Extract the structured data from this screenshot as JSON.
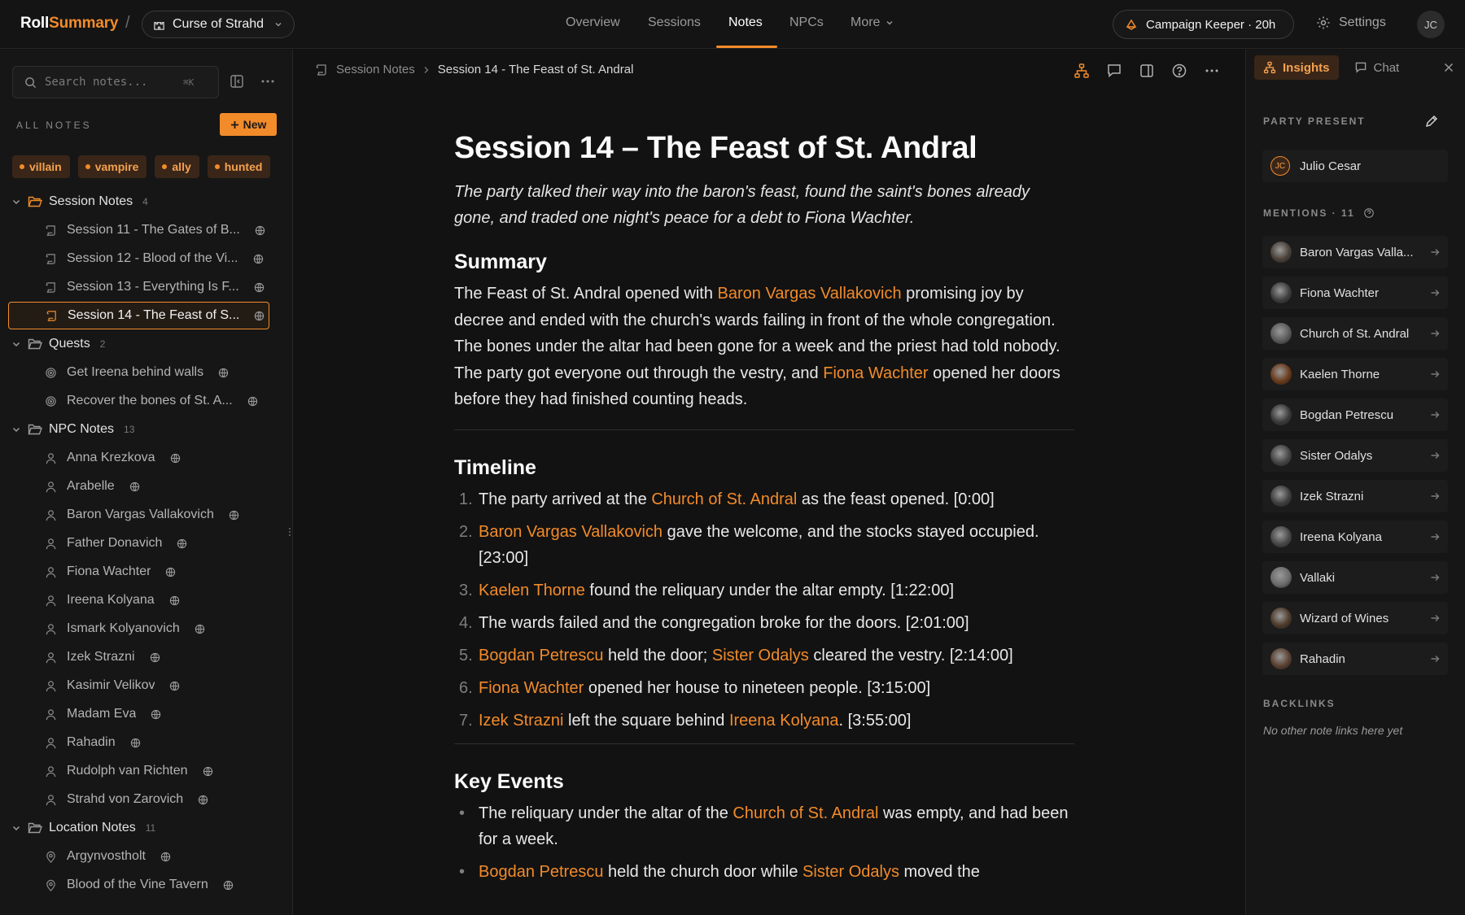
{
  "topbar": {
    "logo_a": "Roll",
    "logo_b": "Summary",
    "campaign": "Curse of Strahd",
    "tabs": [
      "Overview",
      "Sessions",
      "Notes",
      "NPCs",
      "More"
    ],
    "active_tab": "Notes",
    "keeper": "Campaign Keeper · 20h",
    "settings": "Settings",
    "avatar": "JC"
  },
  "sidebar": {
    "search_placeholder": "Search notes...",
    "search_kbd": "⌘K",
    "all_notes": "ALL NOTES",
    "new_label": "New",
    "tags": [
      "villain",
      "vampire",
      "ally",
      "hunted"
    ],
    "folders": {
      "session": {
        "name": "Session Notes",
        "count": "4",
        "items": [
          "Session 11 - The Gates of B...",
          "Session 12 - Blood of the Vi...",
          "Session 13 - Everything Is F...",
          "Session 14 - The Feast of S..."
        ]
      },
      "quests": {
        "name": "Quests",
        "count": "2",
        "items": [
          "Get Ireena behind walls",
          "Recover the bones of St. A..."
        ]
      },
      "npc": {
        "name": "NPC Notes",
        "count": "13",
        "items": [
          "Anna Krezkova",
          "Arabelle",
          "Baron Vargas Vallakovich",
          "Father Donavich",
          "Fiona Wachter",
          "Ireena Kolyana",
          "Ismark Kolyanovich",
          "Izek Strazni",
          "Kasimir Velikov",
          "Madam Eva",
          "Rahadin",
          "Rudolph van Richten",
          "Strahd von Zarovich"
        ]
      },
      "location": {
        "name": "Location Notes",
        "count": "11",
        "items": [
          "Argynvostholt",
          "Blood of the Vine Tavern"
        ]
      }
    }
  },
  "main": {
    "breadcrumb_root": "Session Notes",
    "breadcrumb_current": "Session 14 - The Feast of St. Andral",
    "title": "Session 14 – The Feast of St. Andral",
    "lede": "The party talked their way into the baron's feast, found the saint's bones already gone, and traded one night's peace for a debt to Fiona Wachter.",
    "summary": {
      "heading": "Summary",
      "t1": "The Feast of St. Andral opened with ",
      "l1": "Baron Vargas Vallakovich",
      "t2": " promising joy by decree and ended with the church's wards failing in front of the whole congregation. The bones under the altar had been gone for a week and the priest had told nobody. The party got everyone out through the vestry, and ",
      "l2": "Fiona Wachter",
      "t3": " opened her doors before they had finished counting heads."
    },
    "timeline": {
      "heading": "Timeline",
      "items": [
        {
          "num": "1.",
          "a": "The party arrived at the ",
          "l1": "Church of St. Andral",
          "b": " as the feast opened. [0:00]"
        },
        {
          "num": "2.",
          "l1": "Baron Vargas Vallakovich",
          "b": " gave the welcome, and the stocks stayed occupied. [23:00]"
        },
        {
          "num": "3.",
          "l1": "Kaelen Thorne",
          "b": " found the reliquary under the altar empty. [1:22:00]"
        },
        {
          "num": "4.",
          "b": "The wards failed and the congregation broke for the doors. [2:01:00]"
        },
        {
          "num": "5.",
          "l1": "Bogdan Petrescu",
          "b": " held the door; ",
          "l2": "Sister Odalys",
          "c": " cleared the vestry. [2:14:00]"
        },
        {
          "num": "6.",
          "l1": "Fiona Wachter",
          "b": " opened her house to nineteen people. [3:15:00]"
        },
        {
          "num": "7.",
          "l1": "Izek Strazni",
          "b": " left the square behind ",
          "l2": "Ireena Kolyana",
          "c": ". [3:55:00]"
        }
      ]
    },
    "key_events": {
      "heading": "Key Events",
      "e1_a": "The reliquary under the altar of the ",
      "e1_l": "Church of St. Andral",
      "e1_b": " was empty, and had been for a week.",
      "e2_l1": "Bogdan Petrescu",
      "e2_a": " held the church door while ",
      "e2_l2": "Sister Odalys",
      "e2_b": " moved the"
    }
  },
  "rpanel": {
    "tab_insights": "Insights",
    "tab_chat": "Chat",
    "party_label": "PARTY PRESENT",
    "party_member": "Julio Cesar",
    "party_initials": "JC",
    "mentions_label": "MENTIONS · 11",
    "mentions": [
      "Baron Vargas Valla...",
      "Fiona Wachter",
      "Church of St. Andral",
      "Kaelen Thorne",
      "Bogdan Petrescu",
      "Sister Odalys",
      "Izek Strazni",
      "Ireena Kolyana",
      "Vallaki",
      "Wizard of Wines",
      "Rahadin"
    ],
    "backlinks_label": "BACKLINKS",
    "backlinks_empty": "No other note links here yet"
  },
  "colors": {
    "accent": "#f28b2a",
    "background": "#121212",
    "panel": "#161616"
  }
}
